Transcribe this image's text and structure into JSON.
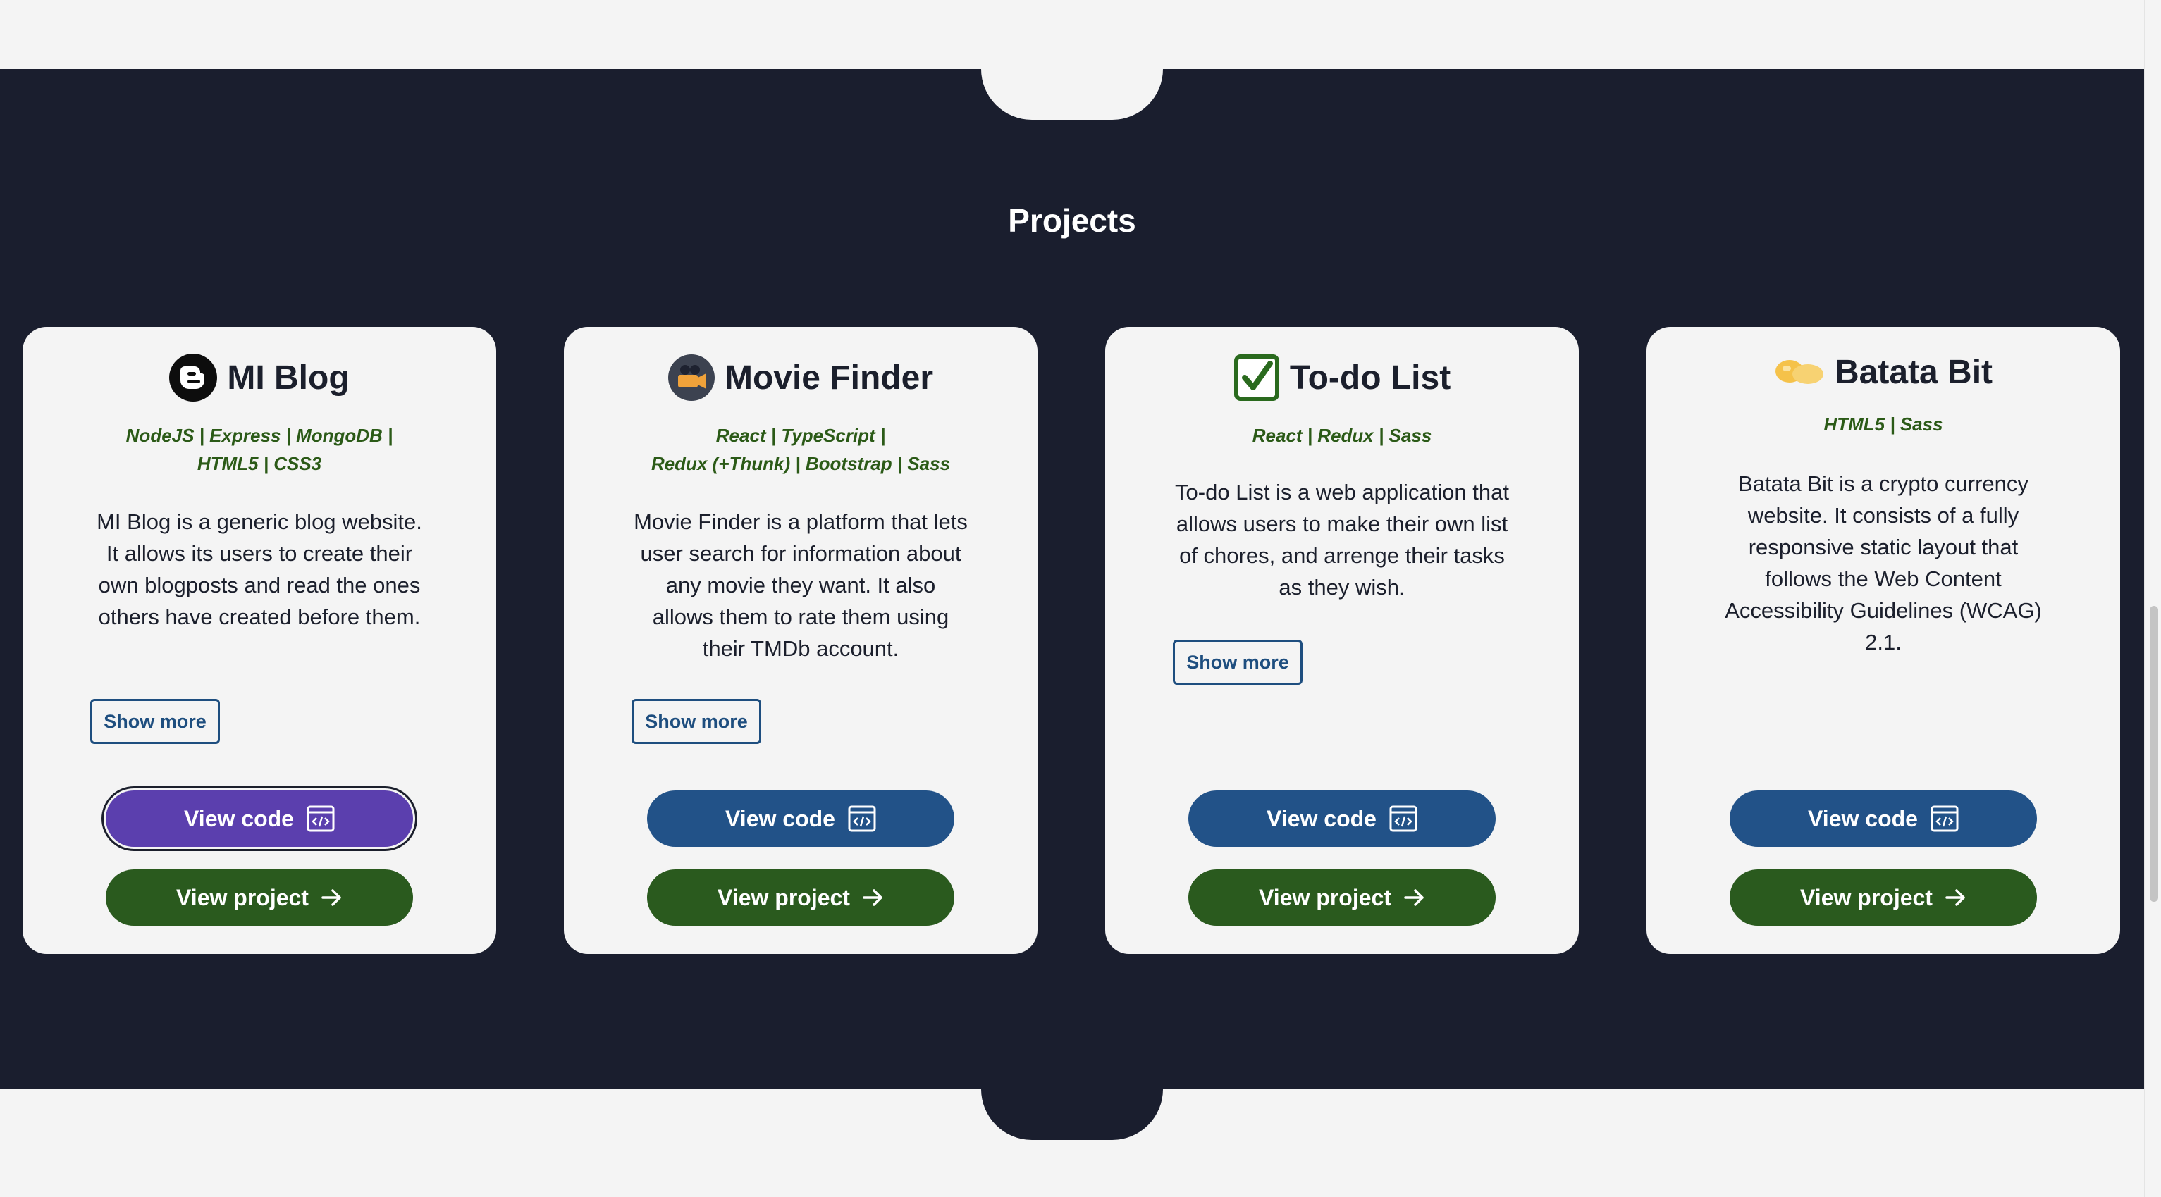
{
  "section": {
    "title": "Projects"
  },
  "colors": {
    "bg_dark": "#1a1e2e",
    "card_bg": "#f4f4f4",
    "code_button": "#225288",
    "code_button_active": "#5b3fae",
    "project_button": "#2a5a1e",
    "tech_text": "#2b5a17"
  },
  "projects": [
    {
      "title": "MI Blog",
      "icon": "blogger-icon",
      "tech_line1": "NodeJS | Express | MongoDB |",
      "tech_line2": "HTML5 | CSS3",
      "description": "MI Blog is a generic blog website. It allows its users to create their own blogposts and read the ones others have created before them.",
      "show_more": "Show more",
      "view_code": "View code",
      "view_project": "View project"
    },
    {
      "title": "Movie Finder",
      "icon": "movie-camera-icon",
      "tech_line1": "React | TypeScript |",
      "tech_line2": "Redux (+Thunk) | Bootstrap | Sass",
      "description": "Movie Finder is a platform that lets user search for information about any movie they want. It also allows them to rate them using their TMDb account.",
      "show_more": "Show more",
      "view_code": "View code",
      "view_project": "View project"
    },
    {
      "title": "To-do List",
      "icon": "checkbox-icon",
      "tech_line1": "React | Redux | Sass",
      "tech_line2": "",
      "description": "To-do List is a web application that allows users to make their own list of chores, and arrenge their tasks as they wish.",
      "show_more": "Show more",
      "view_code": "View code",
      "view_project": "View project"
    },
    {
      "title": "Batata Bit",
      "icon": "batata-logo-icon",
      "tech_line1": "HTML5 | Sass",
      "tech_line2": "",
      "description": "Batata Bit is a crypto currency website. It consists of a fully responsive static layout that follows the Web Content Accessibility Guidelines (WCAG) 2.1.",
      "show_more": "",
      "view_code": "View code",
      "view_project": "View project"
    }
  ]
}
